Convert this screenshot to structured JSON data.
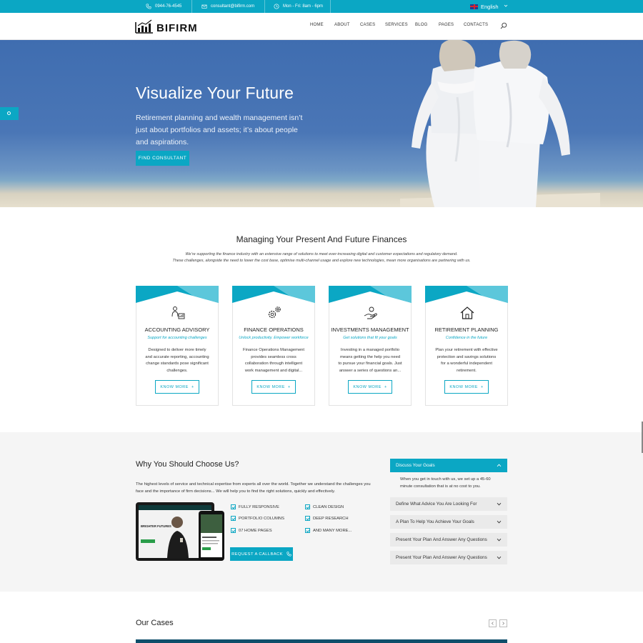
{
  "topbar": {
    "phone": "0944-76-4545",
    "email": "consultant@bifirm.com",
    "hours": "Mon - Fri: 8am - 6pm",
    "language": "English",
    "bg_color": "#0ba7c4"
  },
  "header": {
    "logo_text": "BIFIRM",
    "nav": [
      "HOME",
      "ABOUT",
      "CASES",
      "SERVICES",
      "BLOG",
      "PAGES",
      "CONTACTS"
    ]
  },
  "hero": {
    "title": "Visualize Your Future",
    "text": "Retirement planning and wealth management isn’t just about portfolios and assets; it’s about people and aspirations.",
    "button": "FIND CONSULTANT"
  },
  "services": {
    "title": "Managing Your Present And Future Finances",
    "subtitle_line1": "We’re supporting the finance industry with an extensive range of solutions to meet ever-increasing digital and customer expectations and regulatory demand.",
    "subtitle_line2": "These challenges, alongside the need to lower the cost base, optimise multi-channel usage and explore new technologies, mean more organisations are partnering with us.",
    "cards": [
      {
        "icon": "people-chart-icon",
        "title": "ACCOUNTING ADVISORY",
        "tagline": "Support for accounting challenges",
        "desc": "Designed to deliver more timely and accurate reporting, accounting change standards pose significant challenges.",
        "button": "KNOW MORE"
      },
      {
        "icon": "gears-icon",
        "title": "FINANCE OPERATIONS",
        "tagline": "Unlock productivity. Empower workforce",
        "desc": "Finance Operations Management provides seamless cross collaboration through intelligent work management and digital...",
        "button": "KNOW MORE"
      },
      {
        "icon": "hand-coin-icon",
        "title": "INVESTMENTS MANAGEMENT",
        "tagline": "Get solutions that fit your goals",
        "desc": "Investing in a managed portfolio means getting the help you need to pursue your financial goals. Just answer a series of questions an...",
        "button": "KNOW MORE"
      },
      {
        "icon": "house-icon",
        "title": "RETIREMENT PLANNING",
        "tagline": "Confidence in the future",
        "desc": "Plan your retirement with effective protection and savings solutions for a wonderful independent retirement.",
        "button": "KNOW MORE"
      }
    ]
  },
  "why": {
    "title": "Why You Should Choose Us?",
    "text": "The highest levels of service and technical expertise from experts all over the world. Together we understand the challenges you face and the importance of firm decisions... We will help you to find the right solutions, quickly and effectively.",
    "device_heading": "BRIGHTER FUTURES",
    "features_left": [
      "FULLY RESPONSIVE",
      "PORTFOLIO COLUMNS",
      "07 HOME PAGES"
    ],
    "features_right": [
      "CLEAN DESIGN",
      "DEEP RESEARCH",
      "AND MANY MORE..."
    ],
    "callback_button": "REQUEST A CALLBACK",
    "accordion": [
      {
        "title": "Discuss Your Goals",
        "open": true,
        "body": "When you get in touch with us, we set up a 45-60 minute consultation that is at no cost to you."
      },
      {
        "title": "Define What Advice You Are Looking For",
        "open": false
      },
      {
        "title": "A Plan To Help You Achieve Your Goals",
        "open": false
      },
      {
        "title": "Present Your Plan And Answer Any Questions",
        "open": false
      },
      {
        "title": "Present Your Plan And Answer Any Questions",
        "open": false
      }
    ]
  },
  "cases": {
    "title": "Our Cases"
  }
}
